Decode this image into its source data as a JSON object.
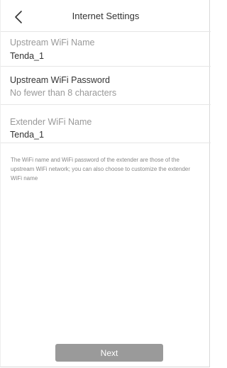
{
  "header": {
    "title": "Internet Settings",
    "back_icon": "chevron-left-icon"
  },
  "form": {
    "upstream_name_label": "Upstream WiFi Name",
    "upstream_name_value": "Tenda_1",
    "upstream_password_label": "Upstream WiFi Password",
    "upstream_password_placeholder": "No fewer than 8 characters",
    "extender_name_label": "Extender WiFi Name",
    "extender_name_value": "Tenda_1"
  },
  "note": "The WiFi name and WiFi password of the extender are those of the upstream WiFi network; you can also choose to customize the extender WiFi name",
  "footer": {
    "next_label": "Next"
  },
  "colors": {
    "button_bg": "#9a9a9a",
    "divider": "#e6e6e6",
    "label_gray": "#999999",
    "text_dark": "#333333"
  }
}
